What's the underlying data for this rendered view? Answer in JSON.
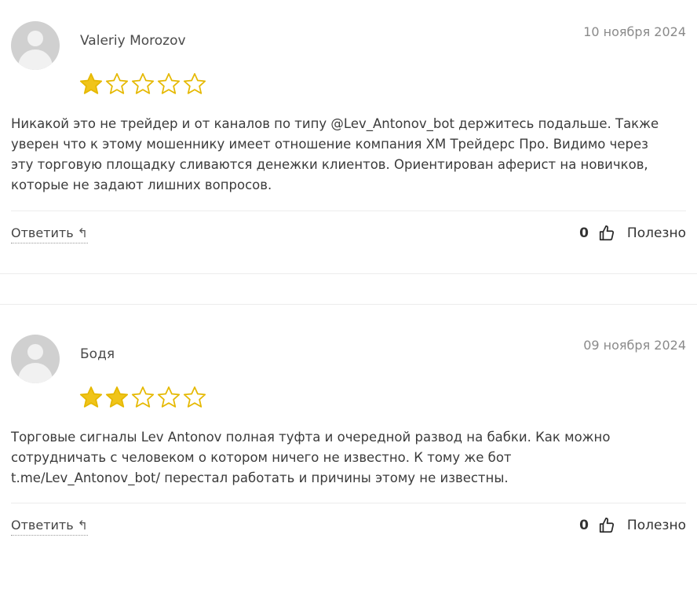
{
  "reviews": [
    {
      "author": "Valeriy Morozov",
      "date": "10 ноября 2024",
      "rating": 1,
      "rating_max": 5,
      "lines": [
        "Никакой это не трейдер и от каналов по типу @Lev_Antonov_bot держитесь подальше. Также",
        "уверен что к этому мошеннику имеет отношение компания ХМ Трейдерс Про. Видимо через",
        "эту торговую площадку сливаются денежки клиентов. Ориентирован аферист на новичков,",
        "которые не задают лишних вопросов."
      ],
      "reply_label": "Ответить",
      "likes": "0",
      "helpful_label": "Полезно"
    },
    {
      "author": "Бодя",
      "date": "09 ноября 2024",
      "rating": 2,
      "rating_max": 5,
      "lines": [
        "Торговые сигналы Lev Antonov полная туфта и очередной развод на бабки. Как можно",
        "сотрудничать с человеком о котором ничего не известно. К тому же бот",
        "t.me/Lev_Antonov_bot/ перестал работать и причины этому не известны."
      ],
      "reply_label": "Ответить",
      "likes": "0",
      "helpful_label": "Полезно"
    }
  ],
  "colors": {
    "star": "#f0c419",
    "star_outline": "#e5b800",
    "text": "#3b3b3b",
    "date": "#8a8a8a"
  },
  "icons": {
    "avatar": "user-avatar-placeholder",
    "reply": "reply-arrow-icon",
    "like": "thumbs-up-icon",
    "star": "star-icon"
  }
}
